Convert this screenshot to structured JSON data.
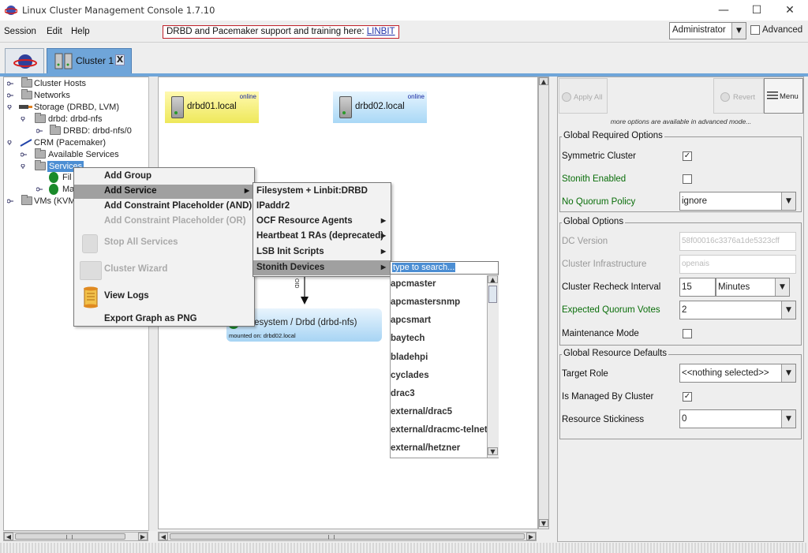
{
  "window": {
    "title": "Linux Cluster Management Console 1.7.10",
    "minimize": "—",
    "maximize": "☐",
    "close": "✕"
  },
  "menubar": {
    "session": "Session",
    "edit": "Edit",
    "help": "Help",
    "banner_text": "DRBD and Pacemaker support and training here: ",
    "banner_link": "LINBIT",
    "user": "Administrator",
    "advanced_label": "Advanced"
  },
  "tabs": {
    "cluster_label": "Cluster 1",
    "close": "X"
  },
  "tree": {
    "cluster_hosts": "Cluster Hosts",
    "networks": "Networks",
    "storage": "Storage (DRBD, LVM)",
    "drbd": "drbd: drbd-nfs",
    "drbd_dev": "DRBD: drbd-nfs/0",
    "crm": "CRM (Pacemaker)",
    "available_services": "Available Services",
    "services": "Services",
    "fil": "Fil",
    "ma": "Ma",
    "vms": "VMs (KVM"
  },
  "graph": {
    "host1_name": "drbd01.local",
    "host1_status": "online",
    "host2_name": "drbd02.local",
    "host2_status": "online",
    "service_title": "ilesystem / Drbd (drbd-nfs)",
    "service_sub": "mounted on: drbd02.local",
    "edge_label": "OID"
  },
  "context_menu": {
    "add_group": "Add Group",
    "add_service": "Add Service",
    "add_constraint_and": "Add Constraint Placeholder (AND)",
    "add_constraint_or": "Add Constraint Placeholder (OR)",
    "stop_all": "Stop All Services",
    "cluster_wizard": "Cluster Wizard",
    "view_logs": "View Logs",
    "export_graph": "Export Graph as PNG"
  },
  "service_submenu": {
    "items": [
      "Filesystem + Linbit:DRBD",
      "IPaddr2",
      "OCF Resource Agents",
      "Heartbeat 1 RAs (deprecated)",
      "LSB Init Scripts",
      "Stonith Devices"
    ]
  },
  "stonith": {
    "search_placeholder": "type to search...",
    "items": [
      "apcmaster",
      "apcmastersnmp",
      "apcsmart",
      "baytech",
      "bladehpi",
      "cyclades",
      "drac3",
      "external/drac5",
      "external/dracmc-telnet",
      "external/hetzner"
    ]
  },
  "right_panel": {
    "apply_all": "Apply All",
    "revert": "Revert",
    "menu": "Menu",
    "advanced_note": "more options are available in advanced mode...",
    "global_required_title": "Global Required Options",
    "symmetric_cluster": "Symmetric Cluster",
    "stonith_enabled": "Stonith Enabled",
    "no_quorum_policy": "No Quorum Policy",
    "no_quorum_value": "ignore",
    "global_options_title": "Global Options",
    "dc_version": "DC Version",
    "dc_version_value": "58f00016c3376a1de5323cff",
    "cluster_infra": "Cluster Infrastructure",
    "cluster_infra_value": "openais",
    "recheck_interval": "Cluster Recheck Interval",
    "recheck_value": "15",
    "recheck_unit": "Minutes",
    "expected_votes": "Expected Quorum Votes",
    "expected_votes_value": "2",
    "maintenance_mode": "Maintenance Mode",
    "global_resource_title": "Global Resource Defaults",
    "target_role": "Target Role",
    "target_role_value": "<<nothing selected>>",
    "is_managed": "Is Managed By Cluster",
    "resource_stickiness": "Resource Stickiness",
    "stickiness_value": "0",
    "check": "✓"
  }
}
